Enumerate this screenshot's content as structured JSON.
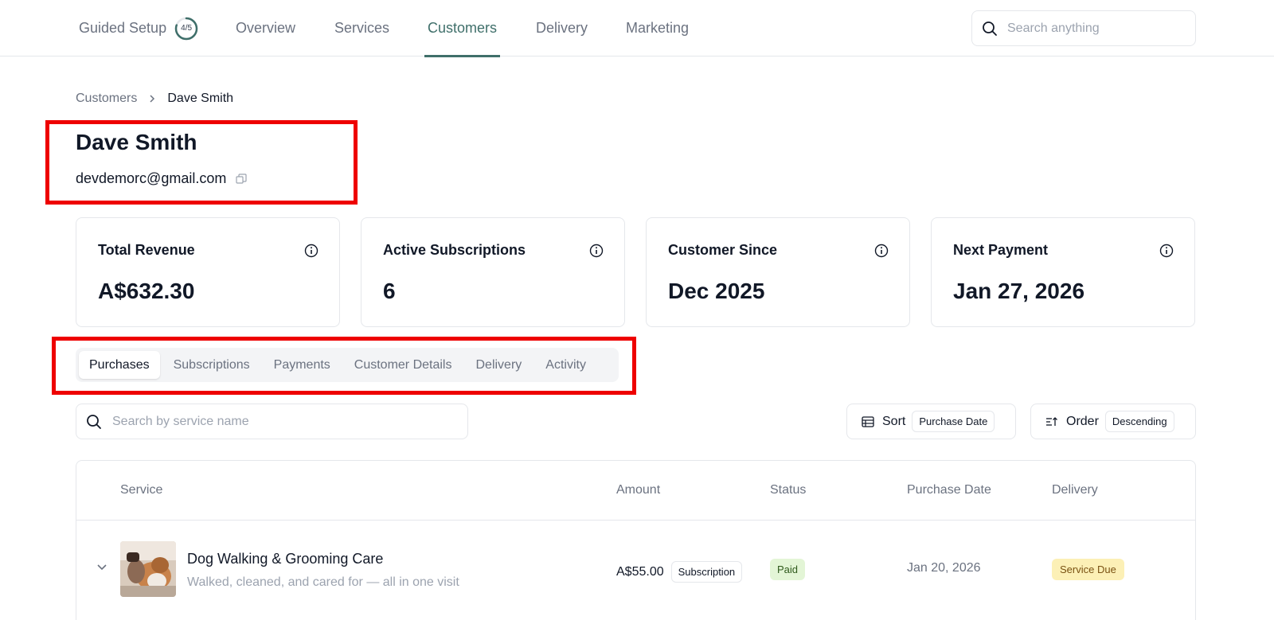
{
  "nav": {
    "guided_setup": "Guided Setup",
    "guided_progress_text": "4/5",
    "guided_progress_fraction": 0.8,
    "items": [
      "Overview",
      "Services",
      "Customers",
      "Delivery",
      "Marketing"
    ],
    "active": "Customers",
    "search_placeholder": "Search anything"
  },
  "breadcrumb": {
    "parent": "Customers",
    "current": "Dave Smith"
  },
  "customer": {
    "name": "Dave Smith",
    "email": "devdemorc@gmail.com"
  },
  "stats": [
    {
      "label": "Total Revenue",
      "value": "A$632.30"
    },
    {
      "label": "Active Subscriptions",
      "value": "6"
    },
    {
      "label": "Customer Since",
      "value": "Dec 2025"
    },
    {
      "label": "Next Payment",
      "value": "Jan 27, 2026"
    }
  ],
  "tabs": [
    "Purchases",
    "Subscriptions",
    "Payments",
    "Customer Details",
    "Delivery",
    "Activity"
  ],
  "active_tab": "Purchases",
  "search": {
    "placeholder": "Search by service name"
  },
  "sort": {
    "label": "Sort",
    "value": "Purchase Date"
  },
  "order": {
    "label": "Order",
    "value": "Descending"
  },
  "table": {
    "columns": [
      "Service",
      "Amount",
      "Status",
      "Purchase Date",
      "Delivery"
    ],
    "rows": [
      {
        "service": "Dog Walking & Grooming Care",
        "description": "Walked, cleaned, and cared for — all in one visit",
        "amount": "A$55.00",
        "type": "Subscription",
        "status": "Paid",
        "purchase_date": "Jan 20, 2026",
        "delivery": "Service Due"
      }
    ]
  },
  "colors": {
    "accent": "#3f6f6a",
    "highlight": "#ee0000",
    "paid_bg": "#e3f5d6",
    "due_bg": "#fcf0b6"
  }
}
